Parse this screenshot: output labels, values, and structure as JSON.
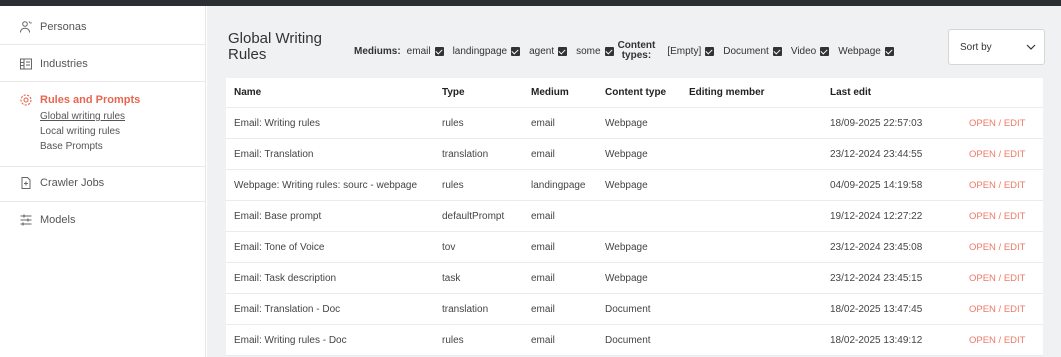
{
  "sidebar": {
    "items": [
      {
        "label": "Personas",
        "icon": "persona-icon"
      },
      {
        "label": "Industries",
        "icon": "building-icon"
      },
      {
        "label": "Rules and Prompts",
        "icon": "gear-icon",
        "active": true
      },
      {
        "label": "Crawler Jobs",
        "icon": "crawler-icon"
      },
      {
        "label": "Models",
        "icon": "sliders-icon"
      }
    ],
    "sub_items": [
      {
        "label": "Global writing rules",
        "current": true
      },
      {
        "label": "Local writing rules"
      },
      {
        "label": "Base Prompts"
      }
    ]
  },
  "main": {
    "title": "Global Writing Rules",
    "mediums_label": "Mediums:",
    "mediums": [
      "email",
      "landingpage",
      "agent",
      "some"
    ],
    "content_types_label_1": "Content",
    "content_types_label_2": "types:",
    "content_types": [
      "[Empty]",
      "Document",
      "Video",
      "Webpage"
    ],
    "sort_label": "Sort by",
    "table": {
      "columns": [
        "Name",
        "Type",
        "Medium",
        "Content type",
        "Editing member",
        "Last edit"
      ],
      "rows": [
        {
          "name": "Email: Writing rules",
          "type": "rules",
          "medium": "email",
          "content_type": "Webpage",
          "member": "",
          "last_edit": "18/09-2025 22:57:03",
          "action": "OPEN / EDIT"
        },
        {
          "name": "Email: Translation",
          "type": "translation",
          "medium": "email",
          "content_type": "Webpage",
          "member": "",
          "last_edit": "23/12-2024 23:44:55",
          "action": "OPEN / EDIT"
        },
        {
          "name": "Webpage: Writing rules: sourc - webpage",
          "type": "rules",
          "medium": "landingpage",
          "content_type": "Webpage",
          "member": "",
          "last_edit": "04/09-2025 14:19:58",
          "action": "OPEN / EDIT"
        },
        {
          "name": "Email: Base prompt",
          "type": "defaultPrompt",
          "medium": "email",
          "content_type": "",
          "member": "",
          "last_edit": "19/12-2024 12:27:22",
          "action": "OPEN / EDIT"
        },
        {
          "name": "Email: Tone of Voice",
          "type": "tov",
          "medium": "email",
          "content_type": "Webpage",
          "member": "",
          "last_edit": "23/12-2024 23:45:08",
          "action": "OPEN / EDIT"
        },
        {
          "name": "Email: Task description",
          "type": "task",
          "medium": "email",
          "content_type": "Webpage",
          "member": "",
          "last_edit": "23/12-2024 23:45:15",
          "action": "OPEN / EDIT"
        },
        {
          "name": "Email: Translation - Doc",
          "type": "translation",
          "medium": "email",
          "content_type": "Document",
          "member": "",
          "last_edit": "18/02-2025 13:47:45",
          "action": "OPEN / EDIT"
        },
        {
          "name": "Email: Writing rules - Doc",
          "type": "rules",
          "medium": "email",
          "content_type": "Document",
          "member": "",
          "last_edit": "18/02-2025 13:49:12",
          "action": "OPEN / EDIT"
        }
      ]
    }
  },
  "colors": {
    "accent": "#e8664f",
    "topbar": "#2b2e33",
    "main_bg": "#f0f1f3"
  }
}
